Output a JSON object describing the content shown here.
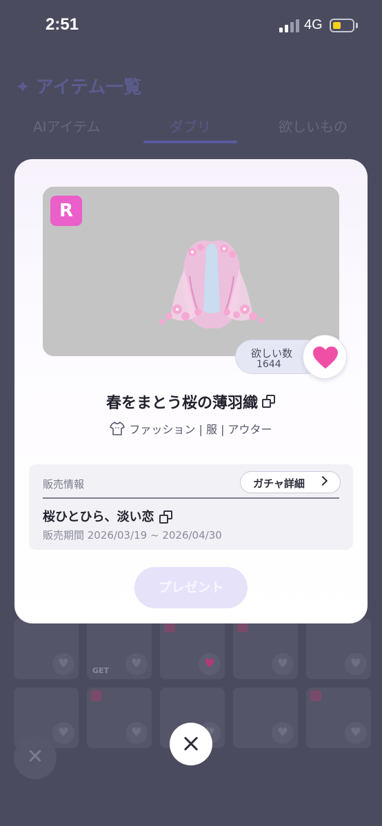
{
  "status_bar": {
    "time": "2:51",
    "network": "4G",
    "battery_color": "#f2d11a"
  },
  "background": {
    "heading": "アイテム一覧",
    "heading_icon": "sparkle-icon",
    "tabs": [
      {
        "label": "AIアイテム"
      },
      {
        "label": "ダブリ"
      },
      {
        "label": "欲しいもの"
      }
    ],
    "active_tab": "ダブリ",
    "tile_get_label": "GET"
  },
  "modal": {
    "rarity": "R",
    "rarity_color": "#ea5fc9",
    "want": {
      "label": "欲しい数",
      "count": "1644",
      "heart_color": "#f04fa6"
    },
    "title": "春をまとう桜の薄羽織",
    "category_icon": "shirt-icon",
    "category": "ファッション | 服 | アウター",
    "sale_info": {
      "label": "販売情報",
      "gacha_button": "ガチャ詳細",
      "name": "桜ひとひら、淡い恋",
      "period": "販売期間 2026/03/19 ~ 2026/04/30"
    },
    "present_button": "プレゼント"
  },
  "close_icon": "close-icon"
}
